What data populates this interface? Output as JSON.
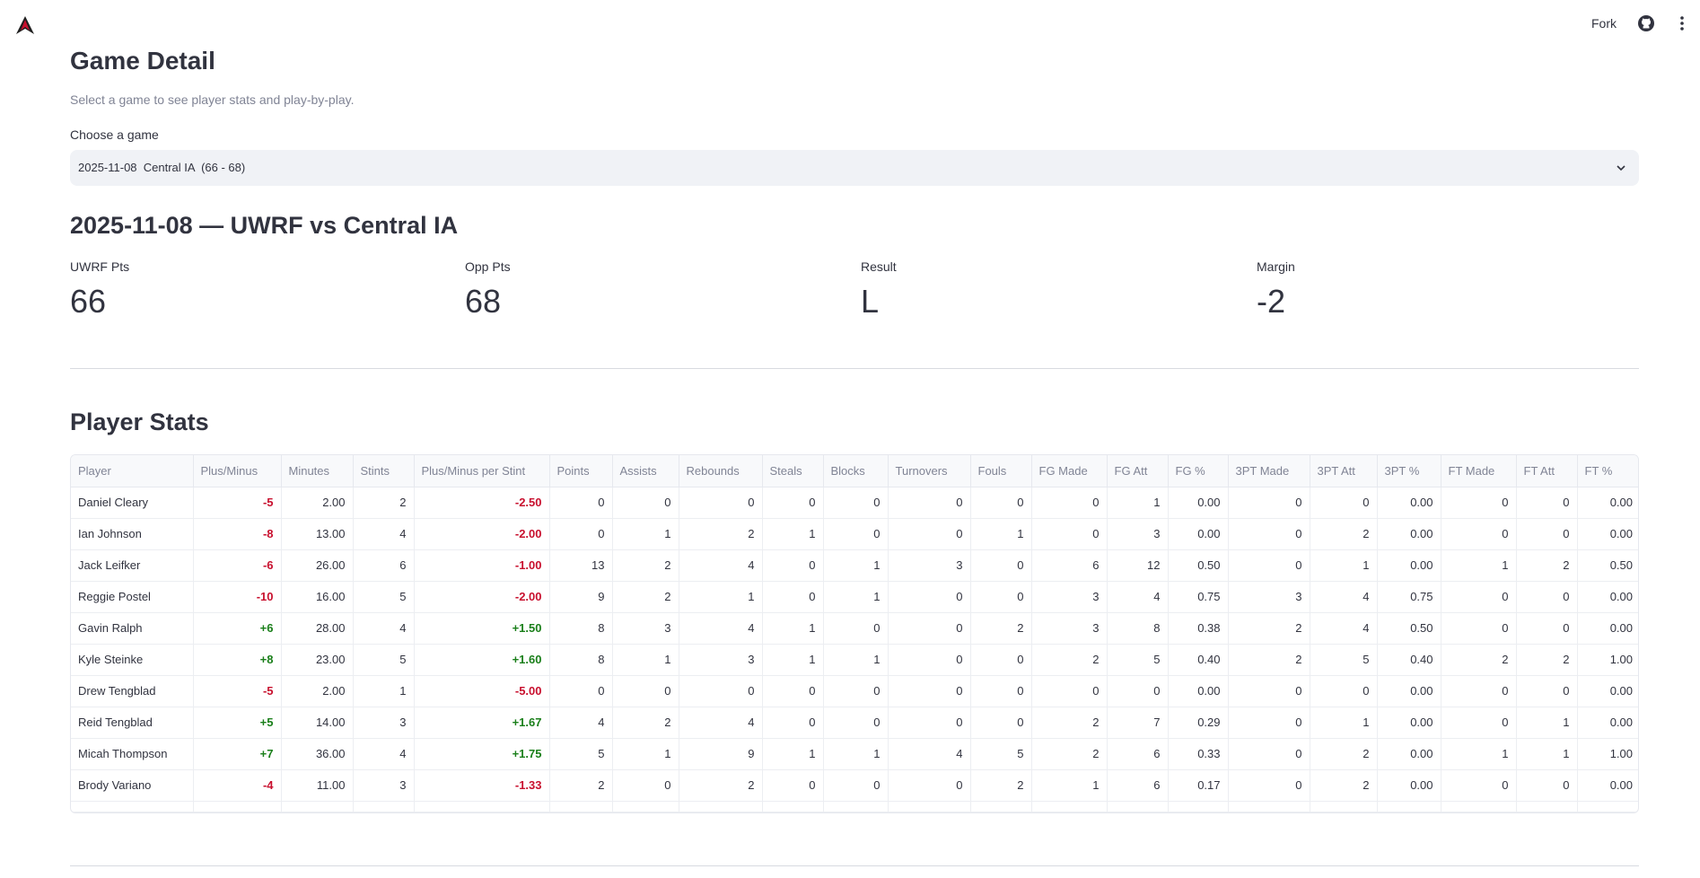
{
  "header": {
    "fork_label": "Fork"
  },
  "page": {
    "title": "Game Detail",
    "caption": "Select a game to see player stats and play-by-play.",
    "select_label": "Choose a game",
    "select_value": "2025-11-08  Central IA  (66 - 68)"
  },
  "game": {
    "heading": "2025-11-08 — UWRF vs Central IA",
    "metrics": [
      {
        "label": "UWRF Pts",
        "value": "66"
      },
      {
        "label": "Opp Pts",
        "value": "68"
      },
      {
        "label": "Result",
        "value": "L"
      },
      {
        "label": "Margin",
        "value": "-2"
      }
    ]
  },
  "player_stats": {
    "heading": "Player Stats",
    "columns": [
      "Player",
      "Plus/Minus",
      "Minutes",
      "Stints",
      "Plus/Minus per Stint",
      "Points",
      "Assists",
      "Rebounds",
      "Steals",
      "Blocks",
      "Turnovers",
      "Fouls",
      "FG Made",
      "FG Att",
      "FG %",
      "3PT Made",
      "3PT Att",
      "3PT %",
      "FT Made",
      "FT Att",
      "FT %"
    ],
    "rows": [
      [
        "Daniel Cleary",
        "-5",
        "2.00",
        "2",
        "-2.50",
        "0",
        "0",
        "0",
        "0",
        "0",
        "0",
        "0",
        "0",
        "1",
        "0.00",
        "0",
        "0",
        "0.00",
        "0",
        "0",
        "0.00"
      ],
      [
        "Ian Johnson",
        "-8",
        "13.00",
        "4",
        "-2.00",
        "0",
        "1",
        "2",
        "1",
        "0",
        "0",
        "1",
        "0",
        "3",
        "0.00",
        "0",
        "2",
        "0.00",
        "0",
        "0",
        "0.00"
      ],
      [
        "Jack Leifker",
        "-6",
        "26.00",
        "6",
        "-1.00",
        "13",
        "2",
        "4",
        "0",
        "1",
        "3",
        "0",
        "6",
        "12",
        "0.50",
        "0",
        "1",
        "0.00",
        "1",
        "2",
        "0.50"
      ],
      [
        "Reggie Postel",
        "-10",
        "16.00",
        "5",
        "-2.00",
        "9",
        "2",
        "1",
        "0",
        "1",
        "0",
        "0",
        "3",
        "4",
        "0.75",
        "3",
        "4",
        "0.75",
        "0",
        "0",
        "0.00"
      ],
      [
        "Gavin Ralph",
        "+6",
        "28.00",
        "4",
        "+1.50",
        "8",
        "3",
        "4",
        "1",
        "0",
        "0",
        "2",
        "3",
        "8",
        "0.38",
        "2",
        "4",
        "0.50",
        "0",
        "0",
        "0.00"
      ],
      [
        "Kyle Steinke",
        "+8",
        "23.00",
        "5",
        "+1.60",
        "8",
        "1",
        "3",
        "1",
        "1",
        "0",
        "0",
        "2",
        "5",
        "0.40",
        "2",
        "5",
        "0.40",
        "2",
        "2",
        "1.00"
      ],
      [
        "Drew Tengblad",
        "-5",
        "2.00",
        "1",
        "-5.00",
        "0",
        "0",
        "0",
        "0",
        "0",
        "0",
        "0",
        "0",
        "0",
        "0.00",
        "0",
        "0",
        "0.00",
        "0",
        "0",
        "0.00"
      ],
      [
        "Reid Tengblad",
        "+5",
        "14.00",
        "3",
        "+1.67",
        "4",
        "2",
        "4",
        "0",
        "0",
        "0",
        "0",
        "2",
        "7",
        "0.29",
        "0",
        "1",
        "0.00",
        "0",
        "1",
        "0.00"
      ],
      [
        "Micah Thompson",
        "+7",
        "36.00",
        "4",
        "+1.75",
        "5",
        "1",
        "9",
        "1",
        "1",
        "4",
        "5",
        "2",
        "6",
        "0.33",
        "0",
        "2",
        "0.00",
        "1",
        "1",
        "1.00"
      ],
      [
        "Brody Variano",
        "-4",
        "11.00",
        "3",
        "-1.33",
        "2",
        "0",
        "2",
        "0",
        "0",
        "0",
        "2",
        "1",
        "6",
        "0.17",
        "0",
        "2",
        "0.00",
        "0",
        "0",
        "0.00"
      ]
    ]
  },
  "colors": {
    "negative": "#c8102e",
    "positive": "#1a7f1a",
    "logo": "#c8102e"
  },
  "icons": [
    "logo-icon",
    "github-icon",
    "kebab-menu-icon",
    "chevron-down-icon"
  ]
}
